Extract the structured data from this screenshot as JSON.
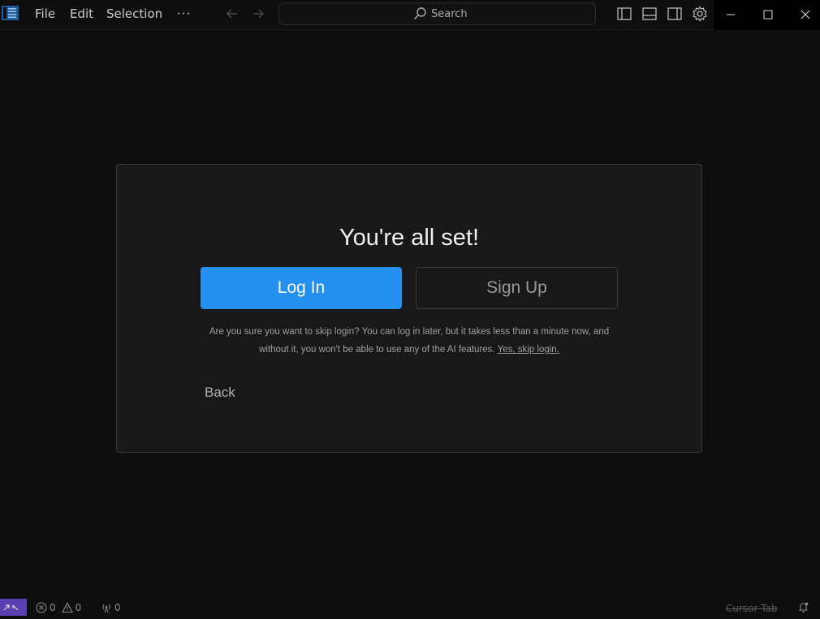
{
  "menu": {
    "file": "File",
    "edit": "Edit",
    "selection": "Selection",
    "more": "···"
  },
  "search": {
    "label": "Search"
  },
  "dialog": {
    "title": "You're all set!",
    "login_label": "Log In",
    "signup_label": "Sign Up",
    "skip_text": "Are you sure you want to skip login? You can log in later, but it takes less than a minute now, and without it, you won't be able to use any of the AI features.",
    "skip_link": "Yes, skip login.",
    "back_label": "Back"
  },
  "status": {
    "errors": "0",
    "warnings": "0",
    "ports": "0",
    "cursor_tab": "Cursor Tab"
  },
  "colors": {
    "accent": "#2490f0",
    "remote": "#5a3fb0",
    "background": "#0e0e0e",
    "dialog_bg": "#181818"
  },
  "icons": [
    "app-logo-icon",
    "arrow-left-icon",
    "arrow-right-icon",
    "search-icon",
    "toggle-primary-sidebar-icon",
    "toggle-panel-icon",
    "toggle-secondary-sidebar-icon",
    "gear-icon",
    "minimize-icon",
    "maximize-icon",
    "close-icon",
    "remote-icon",
    "error-icon",
    "warning-icon",
    "broadcast-icon",
    "bell-icon"
  ]
}
